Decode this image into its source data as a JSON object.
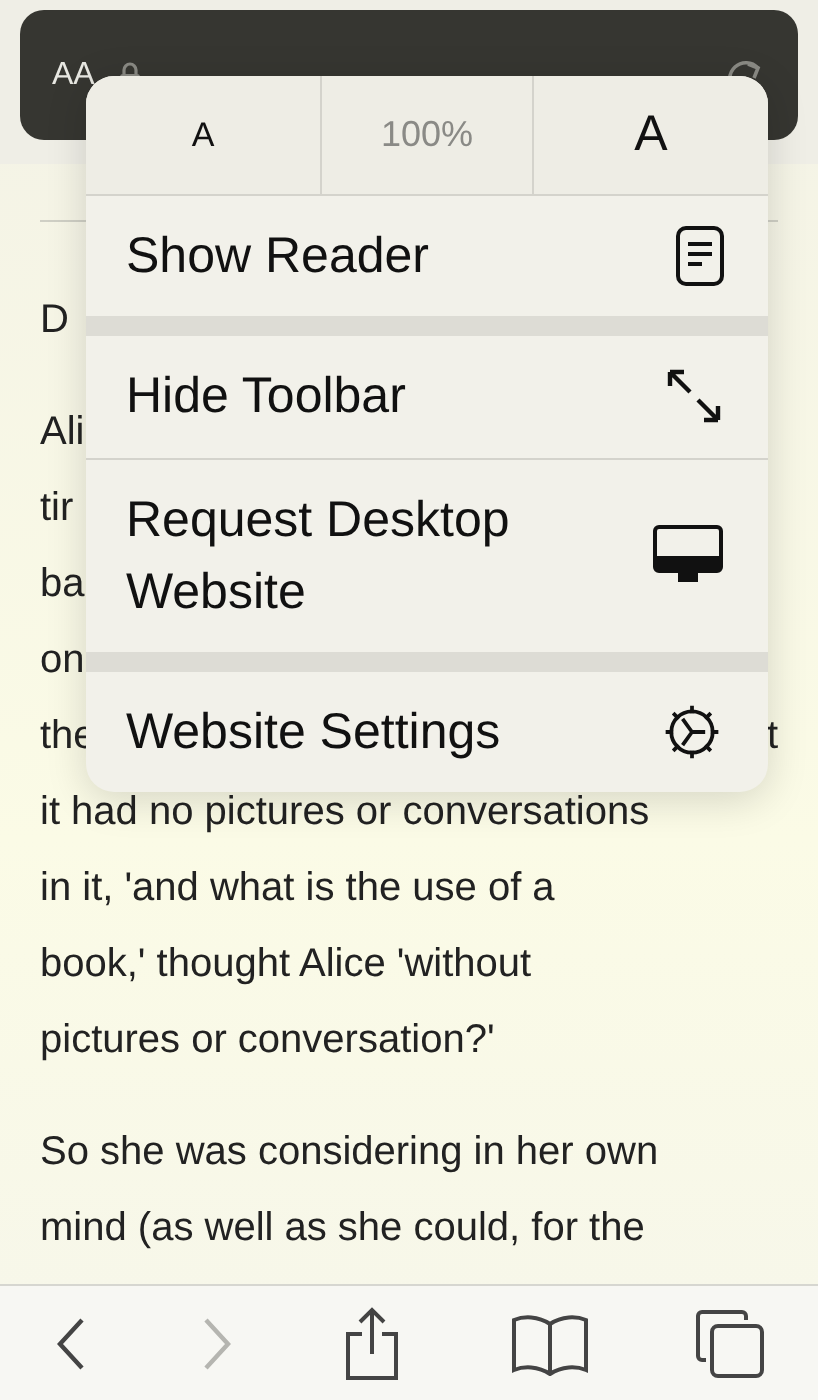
{
  "address_bar": {
    "text_size_button": "AA"
  },
  "article": {
    "paragraphs": [
      {
        "lines": [
          {
            "text": "D"
          }
        ]
      },
      {
        "lines": [
          {
            "text": "Ali"
          },
          {
            "text": "tir"
          },
          {
            "text": "ba"
          },
          {
            "text": "on"
          },
          {
            "text": "the",
            "end_text": "t"
          },
          {
            "text": "it had no pictures or conversations"
          },
          {
            "text": "in it, 'and what is the use of a"
          },
          {
            "text": "book,' thought Alice 'without"
          },
          {
            "text": "pictures or conversation?'"
          }
        ]
      },
      {
        "lines": [
          {
            "text": "So she was considering in her own"
          },
          {
            "text": "mind (as well as she could, for the"
          }
        ]
      }
    ]
  },
  "menu": {
    "font_size": {
      "smaller": "A",
      "zoom": "100%",
      "larger": "A"
    },
    "groups": [
      [
        {
          "label": "Show Reader",
          "kind": "reader"
        }
      ],
      [
        {
          "label": "Hide Toolbar",
          "kind": "expand"
        },
        {
          "label": "Request Desktop Website",
          "kind": "desktop"
        }
      ],
      [
        {
          "label": "Website Settings",
          "kind": "settings"
        }
      ]
    ]
  },
  "toolbar": [
    {
      "kind": "back",
      "disabled": false
    },
    {
      "kind": "forward",
      "disabled": true
    },
    {
      "kind": "share",
      "disabled": false
    },
    {
      "kind": "bookmarks",
      "disabled": false
    },
    {
      "kind": "tabs",
      "disabled": false
    }
  ]
}
